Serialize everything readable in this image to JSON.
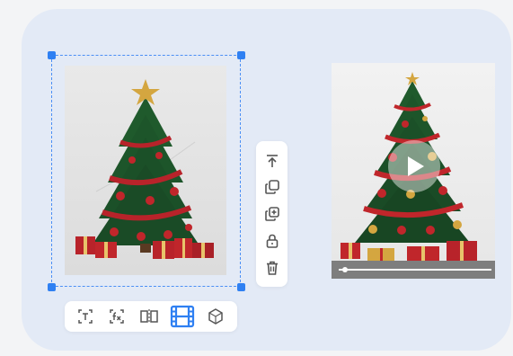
{
  "colors": {
    "accent": "#2f80f2",
    "card_background": "#e3eaf6",
    "icon_gray": "#555555",
    "tree_green": "#1f5a2c",
    "ornament_red": "#c0262b",
    "star_gold": "#d4a640"
  },
  "left_image": {
    "subject": "christmas-tree-image",
    "selected": true
  },
  "right_video": {
    "subject": "christmas-tree-video",
    "progress": 0.05
  },
  "vertical_toolbar": {
    "icons": [
      "bring-to-front-icon",
      "duplicate-icon",
      "add-copy-icon",
      "lock-icon",
      "delete-icon"
    ]
  },
  "bottom_toolbar": {
    "icons": [
      "text-icon",
      "fx-icon",
      "flip-icon",
      "film-icon",
      "3d-icon"
    ],
    "active": "film-icon"
  }
}
